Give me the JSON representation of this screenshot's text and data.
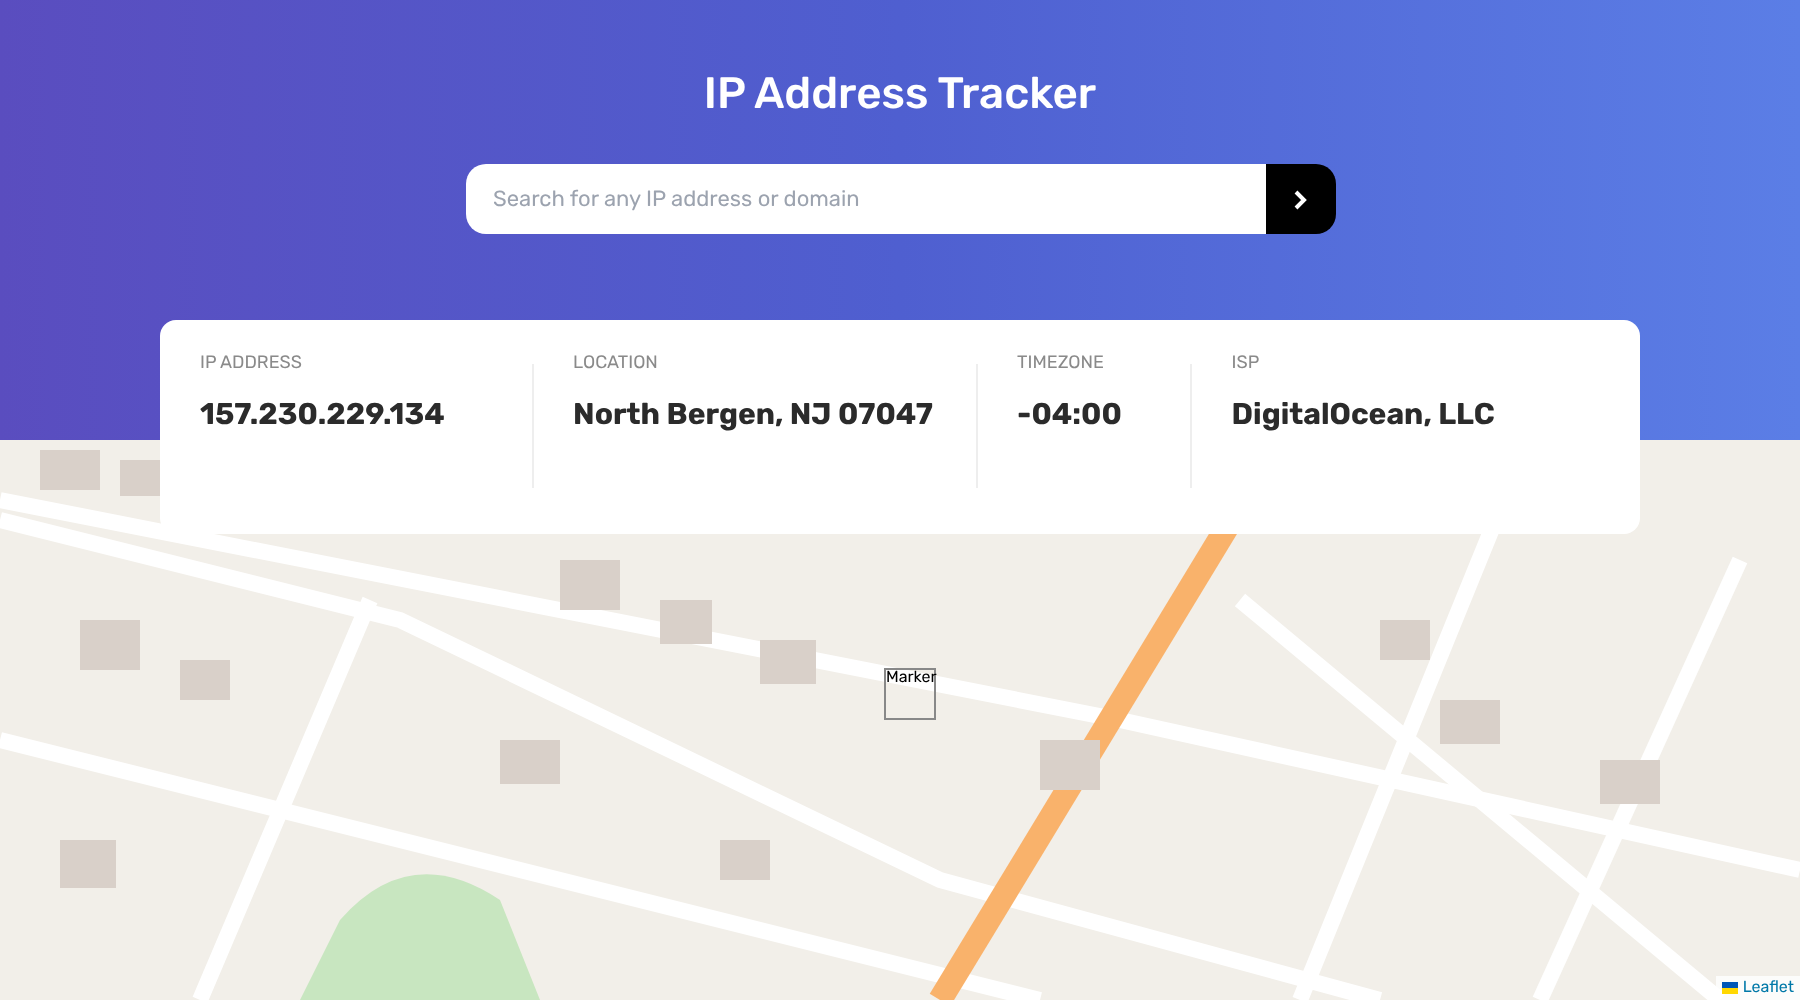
{
  "header": {
    "title": "IP Address Tracker"
  },
  "search": {
    "placeholder": "Search for any IP address or domain"
  },
  "info": [
    {
      "label": "IP ADDRESS",
      "value": "157.230.229.134"
    },
    {
      "label": "LOCATION",
      "value": "North Bergen, NJ 07047"
    },
    {
      "label": "TIMEZONE",
      "value": "-04:00"
    },
    {
      "label": "ISP",
      "value": "DigitalOcean, LLC"
    }
  ],
  "map": {
    "marker": "Marker",
    "attribution": "Leaflet"
  }
}
